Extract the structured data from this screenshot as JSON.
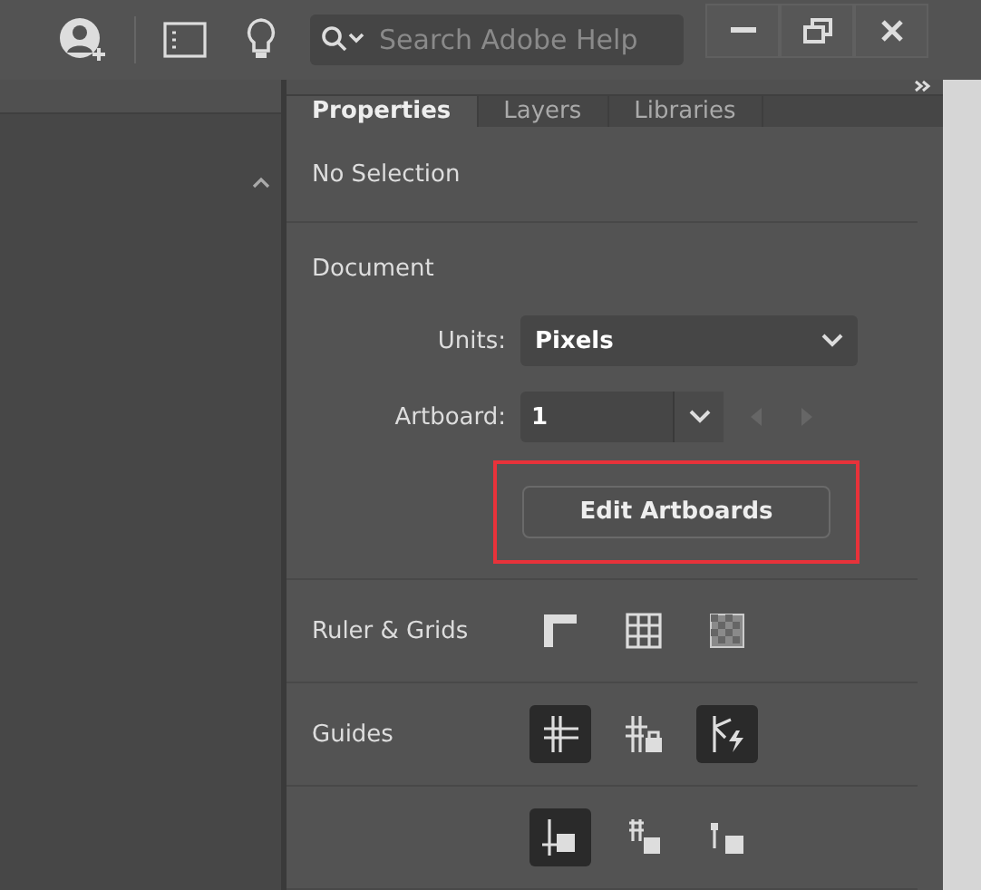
{
  "title_bar": {
    "search": {
      "placeholder": "Search Adobe Help"
    }
  },
  "panel": {
    "tabs": [
      {
        "label": "Properties",
        "selected": true
      },
      {
        "label": "Layers",
        "selected": false
      },
      {
        "label": "Libraries",
        "selected": false
      }
    ],
    "selection": "No Selection",
    "document": {
      "heading": "Document",
      "units": {
        "label": "Units:",
        "value": "Pixels"
      },
      "artboard": {
        "label": "Artboard:",
        "value": "1",
        "previous_disabled": true,
        "next_disabled": true
      },
      "edit_button": {
        "label": "Edit Artboards",
        "highlighted": true
      }
    },
    "sections": [
      {
        "label": "Ruler & Grids",
        "tools": [
          {
            "kind": "ruler",
            "on": false
          },
          {
            "kind": "grid",
            "on": false
          },
          {
            "kind": "transparency",
            "on": false
          }
        ]
      },
      {
        "label": "Guides",
        "tools": [
          {
            "kind": "guides",
            "on": true
          },
          {
            "kind": "lock",
            "on": false
          },
          {
            "kind": "smart",
            "on": true
          }
        ]
      },
      {
        "tools": [
          {
            "kind": "snap",
            "on": true
          },
          {
            "kind": "snapgrid",
            "on": false
          },
          {
            "kind": "snappixel",
            "on": false
          }
        ]
      }
    ]
  }
}
